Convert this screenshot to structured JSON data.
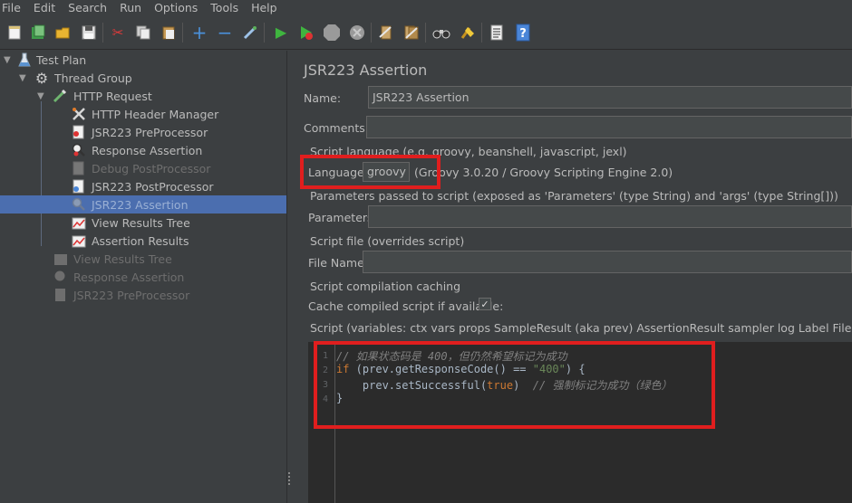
{
  "menu": [
    "File",
    "Edit",
    "Search",
    "Run",
    "Options",
    "Tools",
    "Help"
  ],
  "toolbar": {
    "icons": [
      "new-icon",
      "templates-icon",
      "open-icon",
      "save-icon",
      "cut-icon",
      "copy-icon",
      "paste-icon",
      "expand-icon",
      "collapse-icon",
      "toggle-icon",
      "start-icon",
      "start-no-pauses-icon",
      "stop-icon",
      "shutdown-icon",
      "clear-icon",
      "clear-all-icon",
      "search-icon",
      "reset-search-icon",
      "function-helper-icon",
      "help-icon"
    ]
  },
  "tree": {
    "items": [
      {
        "label": "Test Plan",
        "icon": "test-plan-icon"
      },
      {
        "label": "Thread Group",
        "icon": "thread-group-icon"
      },
      {
        "label": "HTTP Request",
        "icon": "http-request-icon"
      },
      {
        "label": "HTTP Header Manager",
        "icon": "header-manager-icon"
      },
      {
        "label": "JSR223 PreProcessor",
        "icon": "preprocessor-icon"
      },
      {
        "label": "Response Assertion",
        "icon": "assertion-icon"
      },
      {
        "label": "Debug PostProcessor",
        "icon": "postprocessor-icon"
      },
      {
        "label": "JSR223 PostProcessor",
        "icon": "postprocessor-icon"
      },
      {
        "label": "JSR223 Assertion",
        "icon": "assertion-icon"
      },
      {
        "label": "View Results Tree",
        "icon": "listener-icon"
      },
      {
        "label": "Assertion Results",
        "icon": "listener-icon"
      },
      {
        "label": "View Results Tree",
        "icon": "listener-icon"
      },
      {
        "label": "Response Assertion",
        "icon": "assertion-icon"
      },
      {
        "label": "JSR223 PreProcessor",
        "icon": "preprocessor-icon"
      }
    ]
  },
  "panel": {
    "title": "JSR223 Assertion",
    "name_label": "Name:",
    "name_value": "JSR223 Assertion",
    "comments_label": "Comments:",
    "comments_value": "",
    "lang_section": "Script language (e.g. groovy, beanshell, javascript, jexl)",
    "language_label": "Language:",
    "language_value": "groovy",
    "language_desc": "(Groovy 3.0.20 / Groovy Scripting Engine 2.0)",
    "params_section": "Parameters passed to script (exposed as 'Parameters' (type String) and 'args' (type String[]))",
    "params_label": "Parameters:",
    "params_value": "",
    "file_section": "Script file (overrides script)",
    "filename_label": "File Name:",
    "filename_value": "",
    "cache_section": "Script compilation caching",
    "cache_label": "Cache compiled script if available:",
    "cache_checked": "✓",
    "script_section": "Script (variables: ctx vars props SampleResult (aka prev) AssertionResult sampler log Label Filename Parameters args"
  },
  "code": {
    "line_numbers": [
      "1",
      "2",
      "3",
      "4"
    ],
    "line1_comment": "// 如果状态码是 400，但仍然希望标记为成功",
    "line2_kw": "if",
    "line2_a": " (prev.getResponseCode() == ",
    "line2_str": "\"400\"",
    "line2_b": ") {",
    "line3_a": "    prev.setSuccessful(",
    "line3_kw": "true",
    "line3_b": ")  ",
    "line3_comment": "// 强制标记为成功（绿色）",
    "line4": "}"
  },
  "colors": {
    "highlight": "#e01e1e",
    "selection": "#4b6eaf"
  }
}
